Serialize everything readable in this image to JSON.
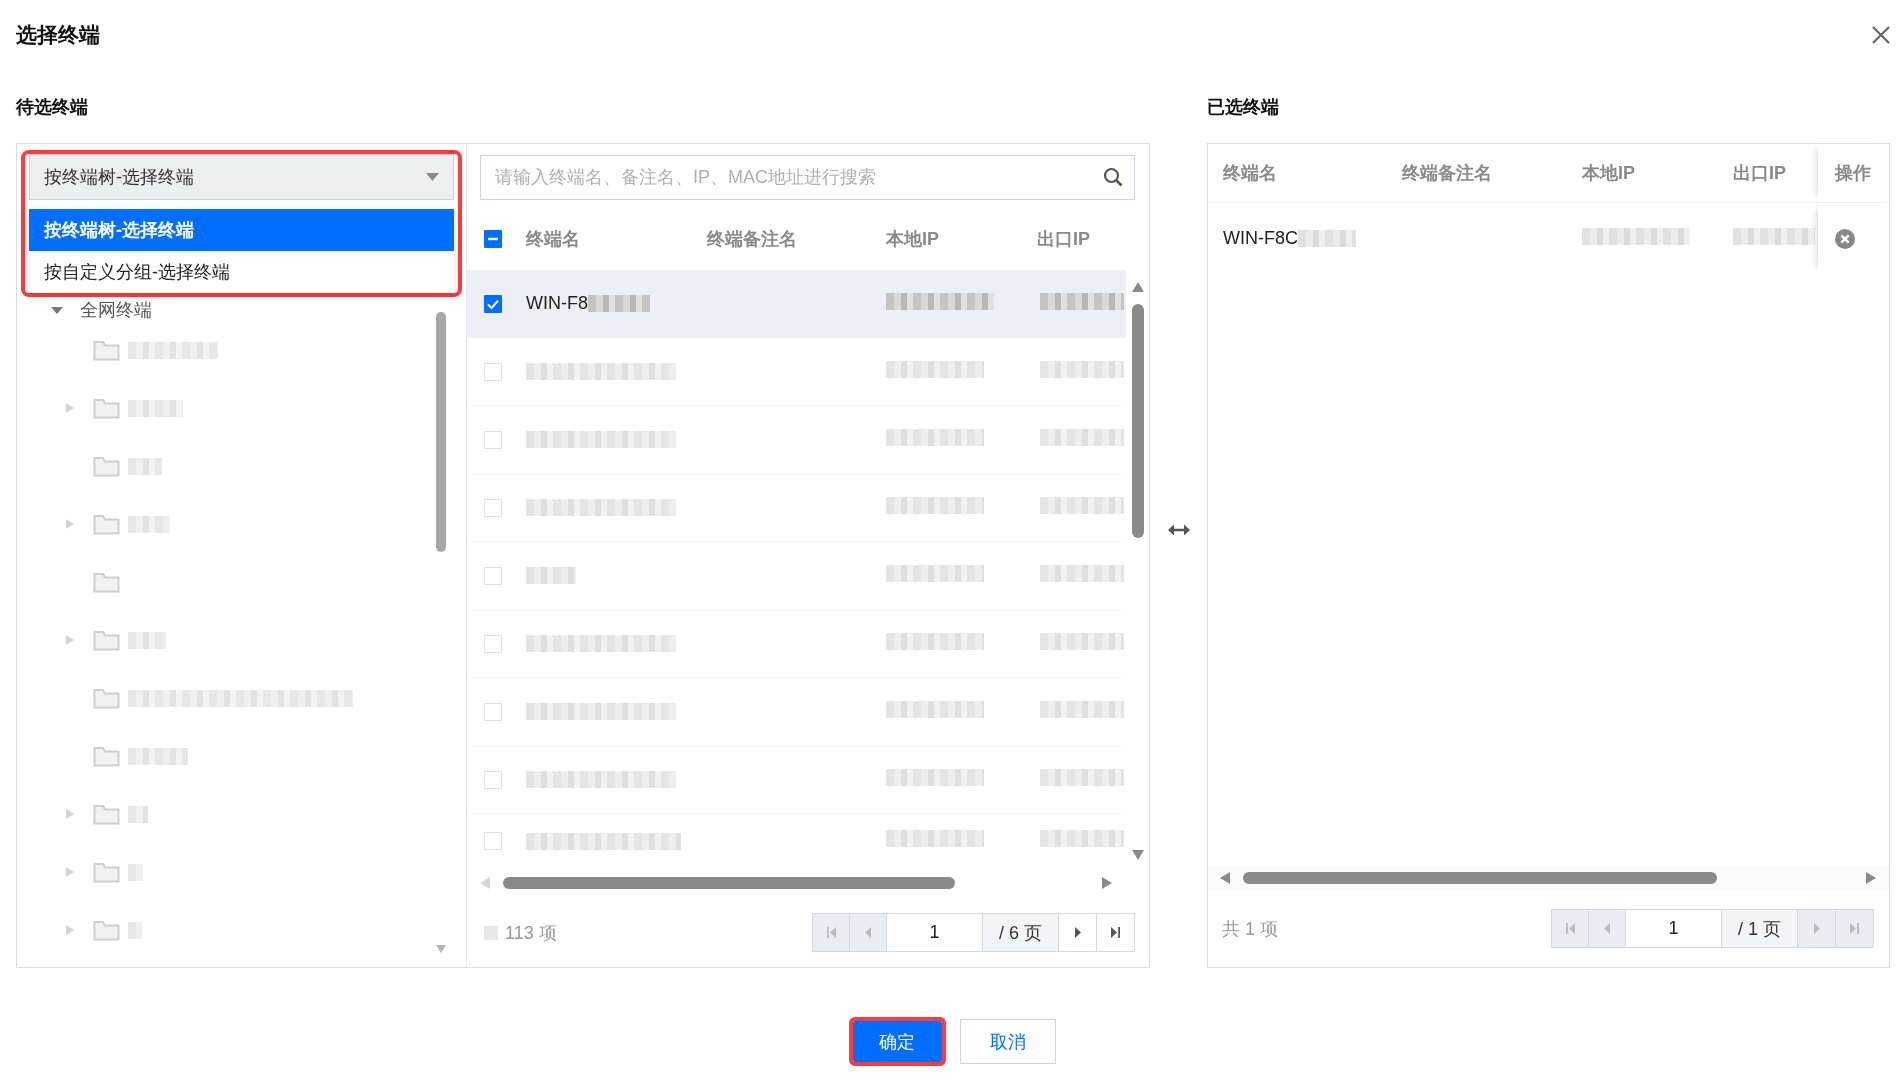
{
  "dialog": {
    "title": "选择终端"
  },
  "available": {
    "label": "待选终端",
    "group_select": {
      "value": "按终端树-选择终端",
      "highlighted": true,
      "expanded": true,
      "options": [
        {
          "label": "按终端树-选择终端",
          "selected": true
        },
        {
          "label": "按自定义分组-选择终端",
          "selected": false
        }
      ]
    },
    "tree": {
      "label": "全网终端",
      "expanded": true,
      "children": [
        {
          "expandable": false
        },
        {
          "expandable": true
        },
        {
          "expandable": false
        },
        {
          "expandable": true
        },
        {
          "expandable": false
        },
        {
          "expandable": true
        },
        {
          "expandable": false
        },
        {
          "expandable": false
        },
        {
          "expandable": true
        },
        {
          "expandable": true
        },
        {
          "expandable": true
        }
      ]
    },
    "search": {
      "placeholder": "请输入终端名、备注名、IP、MAC地址进行搜索"
    },
    "table": {
      "select_all_indeterminate": true,
      "columns": [
        "终端名",
        "终端备注名",
        "本地IP",
        "出口IP"
      ],
      "rows": [
        {
          "checked": true,
          "name": "WIN-F8"
        },
        {
          "checked": false
        },
        {
          "checked": false
        },
        {
          "checked": false
        },
        {
          "checked": false
        },
        {
          "checked": false
        },
        {
          "checked": false
        },
        {
          "checked": false
        },
        {
          "checked": false
        }
      ]
    },
    "footer": {
      "count": "113 项",
      "page": "1",
      "total": "/ 6 页",
      "prev_disabled": true,
      "next_disabled": false
    }
  },
  "selected": {
    "label": "已选终端",
    "table": {
      "columns": [
        "终端名",
        "终端备注名",
        "本地IP",
        "出口IP",
        "操作"
      ],
      "rows": [
        {
          "name": "WIN-F8C"
        }
      ]
    },
    "footer": {
      "count": "共 1 项",
      "page": "1",
      "total": "/ 1 页",
      "prev_disabled": true,
      "next_disabled": true
    }
  },
  "buttons": [
    {
      "label": "确定",
      "kind": "primary",
      "highlighted": true
    },
    {
      "label": "取消",
      "kind": "secondary",
      "highlighted": false
    }
  ]
}
